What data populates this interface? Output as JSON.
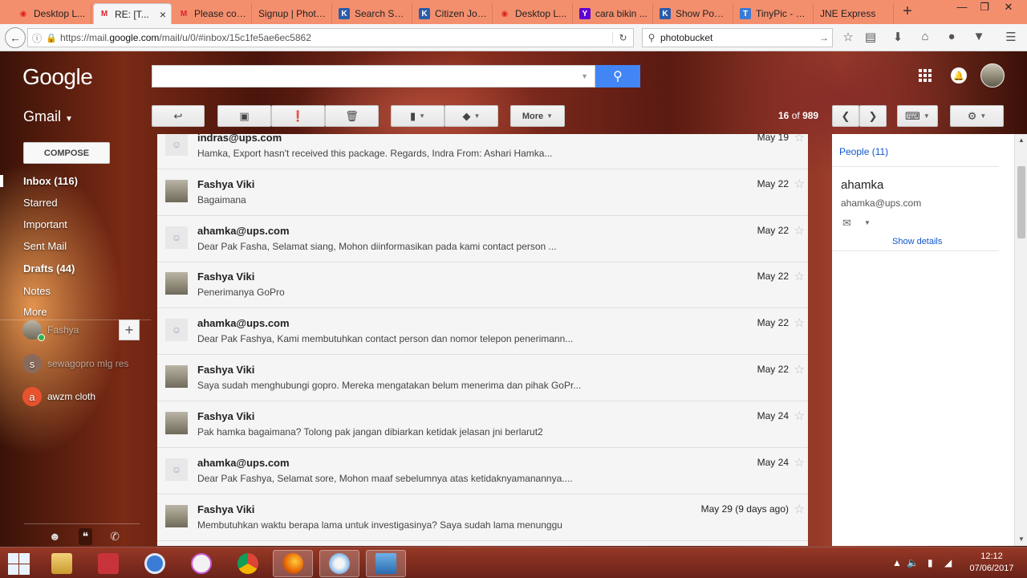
{
  "browser": {
    "tabs": [
      {
        "label": "Desktop L...",
        "favicon": "pinterest-icon",
        "active": false
      },
      {
        "label": "RE: [T...",
        "favicon": "gmail-icon",
        "active": true
      },
      {
        "label": "Please con...",
        "favicon": "gmail-icon",
        "active": false
      },
      {
        "label": "Signup | Photo...",
        "favicon": "blank-icon",
        "active": false
      },
      {
        "label": "Search SU...",
        "favicon": "kompas-icon",
        "active": false
      },
      {
        "label": "Citizen Jou...",
        "favicon": "kompas-icon",
        "active": false
      },
      {
        "label": "Desktop L...",
        "favicon": "pinterest-icon",
        "active": false
      },
      {
        "label": "cara bikin ...",
        "favicon": "yahoo-icon",
        "active": false
      },
      {
        "label": "Show Post...",
        "favicon": "kompas-icon",
        "active": false
      },
      {
        "label": "TinyPic - F...",
        "favicon": "tinypic-icon",
        "active": false
      },
      {
        "label": "JNE Express",
        "favicon": "blank-icon",
        "active": false
      }
    ],
    "url_prefix": "https://mail.",
    "url_domain": "google.com",
    "url_suffix": "/mail/u/0/#inbox/15c1fe5ae6ec5862",
    "search_value": "photobucket"
  },
  "gmail": {
    "logo": "Google",
    "app_label": "Gmail",
    "search_value": "",
    "compose_label": "COMPOSE",
    "nav": [
      {
        "label": "Inbox (116)"
      },
      {
        "label": "Starred"
      },
      {
        "label": "Important"
      },
      {
        "label": "Sent Mail"
      },
      {
        "label": "Drafts (44)"
      },
      {
        "label": "Notes"
      },
      {
        "label": "More"
      }
    ],
    "hangouts": [
      {
        "name": "Fashya",
        "initial": ""
      },
      {
        "name": "sewagopro mlg res",
        "initial": "s"
      },
      {
        "name": "awzm cloth",
        "initial": "a"
      }
    ],
    "toolbar": {
      "more_label": "More"
    },
    "pager": {
      "current": "16",
      "separator": "of",
      "total": "989"
    }
  },
  "messages": [
    {
      "sender": "indras@ups.com",
      "snippet": "Hamka, Export hasn't received this package. Regards, Indra From: Ashari Hamka...",
      "date": "May 19",
      "avatar": "blank"
    },
    {
      "sender": "Fashya Viki",
      "snippet": "Bagaimana",
      "date": "May 22",
      "avatar": "photo"
    },
    {
      "sender": "ahamka@ups.com",
      "snippet": "Dear Pak Fasha, Selamat siang, Mohon diinformasikan pada kami contact person ...",
      "date": "May 22",
      "avatar": "blank"
    },
    {
      "sender": "Fashya Viki",
      "snippet": "Penerimanya GoPro",
      "date": "May 22",
      "avatar": "photo"
    },
    {
      "sender": "ahamka@ups.com",
      "snippet": "Dear Pak Fashya, Kami membutuhkan contact person dan nomor telepon penerimann...",
      "date": "May 22",
      "avatar": "blank"
    },
    {
      "sender": "Fashya Viki",
      "snippet": "Saya sudah menghubungi gopro. Mereka mengatakan belum menerima dan pihak GoPr...",
      "date": "May 22",
      "avatar": "photo"
    },
    {
      "sender": "Fashya Viki",
      "snippet": "Pak hamka bagaimana? Tolong pak jangan dibiarkan ketidak jelasan jni berlarut2",
      "date": "May 24",
      "avatar": "photo"
    },
    {
      "sender": "ahamka@ups.com",
      "snippet": "Dear Pak Fashya, Selamat sore, Mohon maaf sebelumnya atas ketidaknyamanannya....",
      "date": "May 24",
      "avatar": "blank"
    },
    {
      "sender": "Fashya Viki",
      "snippet": "Membutuhkan waktu berapa lama untuk investigasinya? Saya sudah lama menunggu",
      "date": "May 29 (9 days ago)",
      "avatar": "photo"
    }
  ],
  "people_panel": {
    "people_link": "People (11)",
    "name": "ahamka",
    "email": "ahamka@ups.com",
    "show_details": "Show details"
  },
  "taskbar": {
    "time": "12:12",
    "date": "07/06/2017"
  },
  "colors": {
    "accent_blue": "#4285f4",
    "link_blue": "#1155cc",
    "tab_strip": "#f48f6e"
  }
}
